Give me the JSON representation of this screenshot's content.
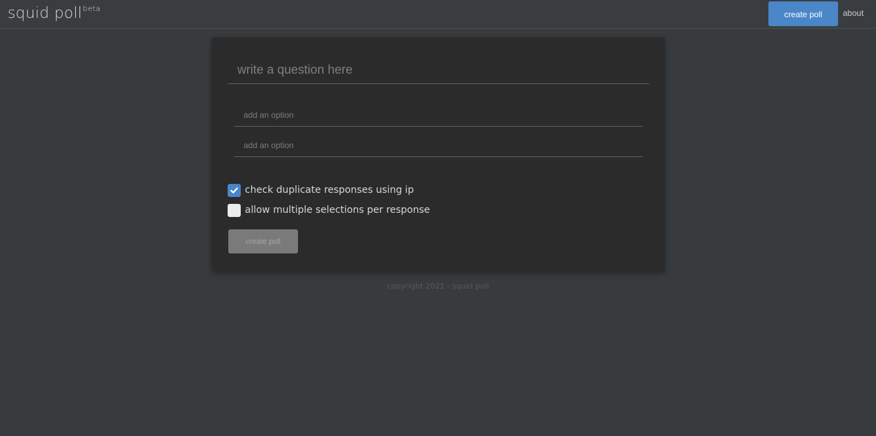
{
  "header": {
    "brand": "squid poll",
    "brand_badge": "beta",
    "create_poll_label": "create poll",
    "about_label": "about"
  },
  "form": {
    "question_placeholder": "write a question here",
    "question_value": "",
    "options": [
      {
        "placeholder": "add an option",
        "value": ""
      },
      {
        "placeholder": "add an option",
        "value": ""
      }
    ],
    "settings": [
      {
        "label": "check duplicate responses using ip",
        "checked": true
      },
      {
        "label": "allow multiple selections per response",
        "checked": false
      }
    ],
    "submit_label": "create poll"
  },
  "footer": {
    "copyright": "copyright 2021 - squid poll"
  },
  "colors": {
    "accent": "#4a86c8",
    "background": "#383b3e",
    "card": "#2b2b2b"
  }
}
